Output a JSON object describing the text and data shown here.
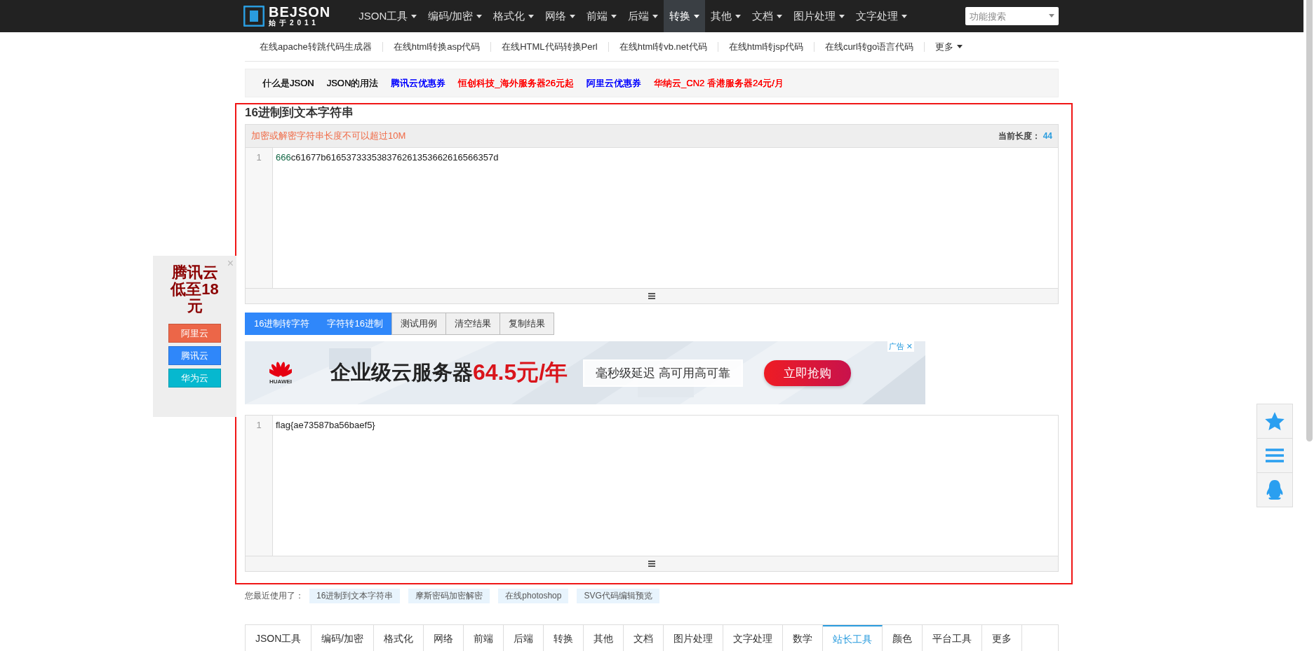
{
  "logo": {
    "name": "BEJSON",
    "tagline": "始于2011"
  },
  "nav": [
    {
      "label": "JSON工具",
      "selected": false
    },
    {
      "label": "编码/加密",
      "selected": false
    },
    {
      "label": "格式化",
      "selected": false
    },
    {
      "label": "网络",
      "selected": false
    },
    {
      "label": "前端",
      "selected": false
    },
    {
      "label": "后端",
      "selected": false
    },
    {
      "label": "转换",
      "selected": true
    },
    {
      "label": "其他",
      "selected": false
    },
    {
      "label": "文档",
      "selected": false
    },
    {
      "label": "图片处理",
      "selected": false
    },
    {
      "label": "文字处理",
      "selected": false
    }
  ],
  "search": {
    "placeholder": "功能搜索"
  },
  "subnav": {
    "items": [
      "在线apache转跳代码生成器",
      "在线html转换asp代码",
      "在线HTML代码转换Perl",
      "在线html转vb.net代码",
      "在线html转jsp代码",
      "在线curl转go语言代码"
    ],
    "more": "更多"
  },
  "links": [
    {
      "label": "什么是JSON",
      "color": "#222222"
    },
    {
      "label": "JSON的用法",
      "color": "#222222"
    },
    {
      "label": "腾讯云优惠券",
      "color": "#0000ff"
    },
    {
      "label": "恒创科技_海外服务器26元起",
      "color": "#ff0000"
    },
    {
      "label": "阿里云优惠券",
      "color": "#0000ff"
    },
    {
      "label": "华纳云_CN2 香港服务器24元/月",
      "color": "#ff0000"
    }
  ],
  "title": "16进制到文本字符串",
  "input_panel": {
    "notice": "加密或解密字符串长度不可以超过10M",
    "length_label": "当前长度：",
    "length_value": "44",
    "lines": [
      {
        "number": "1",
        "tokens": [
          {
            "text": "666",
            "kind": "number"
          },
          {
            "text": "c61677b616537333538376261353662616566357d",
            "kind": "plain"
          }
        ]
      }
    ]
  },
  "buttons": [
    {
      "label": "16进制转字符",
      "kind": "primary"
    },
    {
      "label": "字符转16进制",
      "kind": "primary"
    },
    {
      "label": "测试用例",
      "kind": "default"
    },
    {
      "label": "清空结果",
      "kind": "default"
    },
    {
      "label": "复制结果",
      "kind": "default"
    }
  ],
  "banner": {
    "ad_label": "广告",
    "ad_close": "✕",
    "brand": "HUAWEI",
    "headline": "企业级云服务器",
    "price": "64.5元/年",
    "tagline": "毫秒级延迟 高可用高可靠",
    "cta": "立即抢购"
  },
  "output_panel": {
    "lines": [
      {
        "number": "1",
        "tokens": [
          {
            "text": "flag{ae73587ba56baef5}",
            "kind": "plain"
          }
        ]
      }
    ]
  },
  "recent": {
    "label": "您最近使用了：",
    "items": [
      "16进制到文本字符串",
      "摩斯密码加密解密",
      "在线photoshop",
      "SVG代码编辑预览"
    ]
  },
  "bottom_tabs": [
    {
      "label": "JSON工具",
      "selected": false
    },
    {
      "label": "编码/加密",
      "selected": false
    },
    {
      "label": "格式化",
      "selected": false
    },
    {
      "label": "网络",
      "selected": false
    },
    {
      "label": "前端",
      "selected": false
    },
    {
      "label": "后端",
      "selected": false
    },
    {
      "label": "转换",
      "selected": false
    },
    {
      "label": "其他",
      "selected": false
    },
    {
      "label": "文档",
      "selected": false
    },
    {
      "label": "图片处理",
      "selected": false
    },
    {
      "label": "文字处理",
      "selected": false
    },
    {
      "label": "数学",
      "selected": false
    },
    {
      "label": "站长工具",
      "selected": true
    },
    {
      "label": "颜色",
      "selected": false
    },
    {
      "label": "平台工具",
      "selected": false
    },
    {
      "label": "更多",
      "selected": false
    }
  ],
  "side_ad": {
    "headline": "腾讯云低至18元",
    "close": "×",
    "buttons": [
      {
        "label": "阿里云",
        "color": "#ec6648"
      },
      {
        "label": "腾讯云",
        "color": "#2f87fa"
      },
      {
        "label": "华为云",
        "color": "#06b8cf"
      }
    ]
  }
}
